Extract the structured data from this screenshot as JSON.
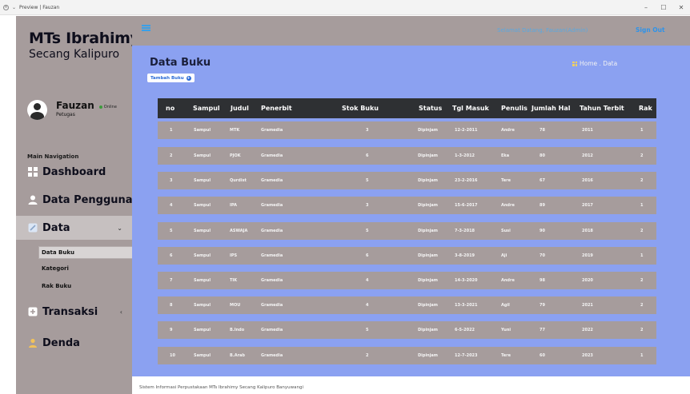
{
  "window": {
    "title": "Preview | Fauzan",
    "controls": [
      "–",
      "☐",
      "✕"
    ]
  },
  "sidebar": {
    "brand_title": "MTs Ibrahimy",
    "brand_subtitle": "Secang Kalipuro",
    "user_name": "Fauzan",
    "user_status": "Online",
    "user_role": "Petugas",
    "nav_header": "Main Navigation",
    "items": [
      {
        "label": "Dashboard",
        "icon": "dashboard-icon"
      },
      {
        "label": "Data Pengguna",
        "icon": "user-icon"
      },
      {
        "label": "Data",
        "icon": "data-icon",
        "expanded": true
      },
      {
        "label": "Transaksi",
        "icon": "plus-icon"
      },
      {
        "label": "Denda",
        "icon": "person-icon"
      }
    ],
    "data_submenu": [
      "Data Buku",
      "Kategori",
      "Rak Buku"
    ],
    "active_submenu": "Data Buku"
  },
  "header": {
    "welcome": "Selamat Datang, Fauzan(Admin)",
    "signout": "Sign Out"
  },
  "main": {
    "page_title": "Data Buku",
    "add_button": "Tambah Buku",
    "breadcrumb": "Home . Data"
  },
  "table": {
    "columns": [
      "no",
      "Sampul",
      "Judul",
      "Penerbit",
      "Stok Buku",
      "Status",
      "Tgl Masuk",
      "Penulis",
      "Jumlah Hal",
      "Tahun Terbit",
      "Rak"
    ],
    "rows": [
      [
        "1",
        "Sampul",
        "MTK",
        "Gramedia",
        "3",
        "Dipinjam",
        "12-2-2011",
        "Andre",
        "78",
        "2011",
        "1"
      ],
      [
        "2",
        "Sampul",
        "PJOK",
        "Gramedia",
        "6",
        "Dipinjam",
        "1-3-2012",
        "Eka",
        "80",
        "2012",
        "2"
      ],
      [
        "3",
        "Sampul",
        "Qurdist",
        "Gramedia",
        "5",
        "Dipinjam",
        "23-2-2016",
        "Tere",
        "67",
        "2016",
        "2"
      ],
      [
        "4",
        "Sampul",
        "IPA",
        "Gramedia",
        "3",
        "Dipinjam",
        "15-6-2017",
        "Andre",
        "89",
        "2017",
        "1"
      ],
      [
        "5",
        "Sampul",
        "ASWAJA",
        "Gramedia",
        "5",
        "Dipinjam",
        "7-3-2018",
        "Susi",
        "90",
        "2018",
        "2"
      ],
      [
        "6",
        "Sampul",
        "IPS",
        "Gramedia",
        "6",
        "Dipinjam",
        "3-8-2019",
        "Aji",
        "70",
        "2019",
        "1"
      ],
      [
        "7",
        "Sampul",
        "TIK",
        "Gramedia",
        "4",
        "Dipinjam",
        "14-3-2020",
        "Andre",
        "98",
        "2020",
        "2"
      ],
      [
        "8",
        "Sampul",
        "MOU",
        "Gramedia",
        "4",
        "Dipinjam",
        "13-3-2021",
        "Agil",
        "79",
        "2021",
        "2"
      ],
      [
        "9",
        "Sampul",
        "B.Indo",
        "Gramedia",
        "5",
        "Dipinjam",
        "6-5-2022",
        "Yuni",
        "77",
        "2022",
        "2"
      ],
      [
        "10",
        "Sampul",
        "B.Arab",
        "Gramedia",
        "2",
        "Dipinjam",
        "12-7-2023",
        "Tere",
        "60",
        "2023",
        "1"
      ]
    ]
  },
  "footer": {
    "text": "Sistem Informasi Perpustakaan MTs Ibrahimy Secang Kalipuro Banyuwangi"
  },
  "colors": {
    "sidebar_bg": "#a69c9c",
    "content_bg": "#8ba1f1",
    "table_header_bg": "#2e3033",
    "row_bg": "#a69c9c",
    "accent_blue": "#2e93ea"
  }
}
